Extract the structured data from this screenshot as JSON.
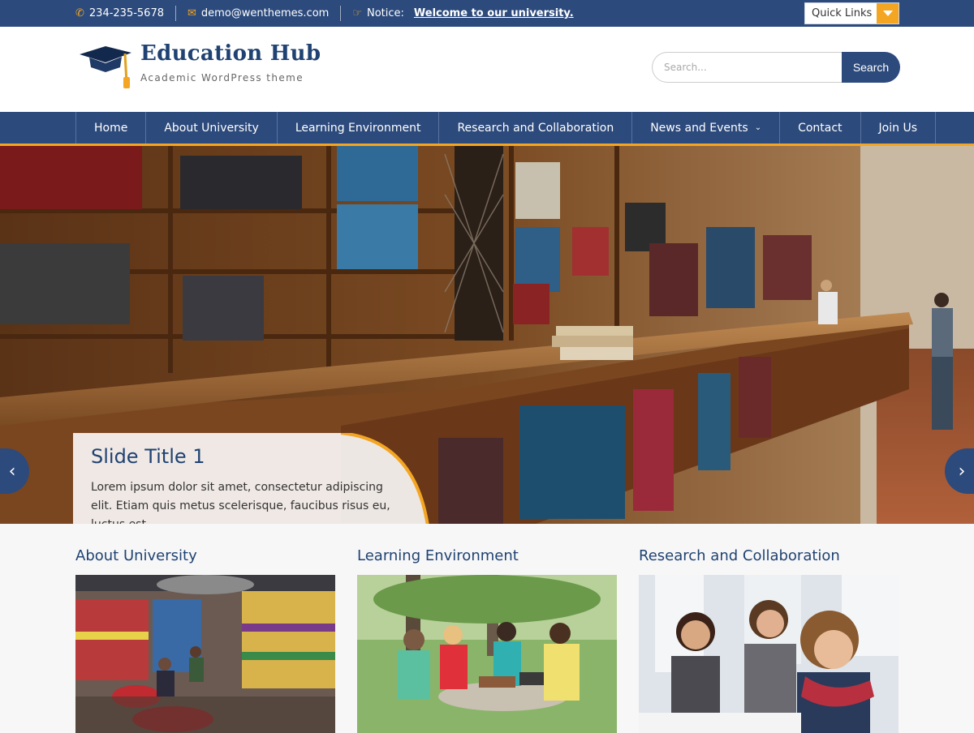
{
  "topbar": {
    "phone": "234-235-5678",
    "email": "demo@wenthemes.com",
    "notice_label": "Notice:",
    "notice_text": "Welcome to our university.",
    "quick_links": "Quick Links"
  },
  "header": {
    "title": "Education Hub",
    "tagline": "Academic WordPress theme",
    "search_placeholder": "Search...",
    "search_button": "Search"
  },
  "nav": [
    {
      "label": "Home"
    },
    {
      "label": "About University"
    },
    {
      "label": "Learning Environment"
    },
    {
      "label": "Research and Collaboration"
    },
    {
      "label": "News and Events"
    },
    {
      "label": "Contact"
    },
    {
      "label": "Join Us"
    }
  ],
  "slider": {
    "title": "Slide Title 1",
    "text": "Lorem ipsum dolor sit amet, consectetur adipiscing elit. Etiam quis metus scelerisque, faucibus risus eu, luctus est."
  },
  "features": [
    {
      "title": "About University"
    },
    {
      "title": "Learning Environment"
    },
    {
      "title": "Research and Collaboration"
    }
  ],
  "colors": {
    "primary": "#2c4a7c",
    "accent": "#f4a522"
  }
}
